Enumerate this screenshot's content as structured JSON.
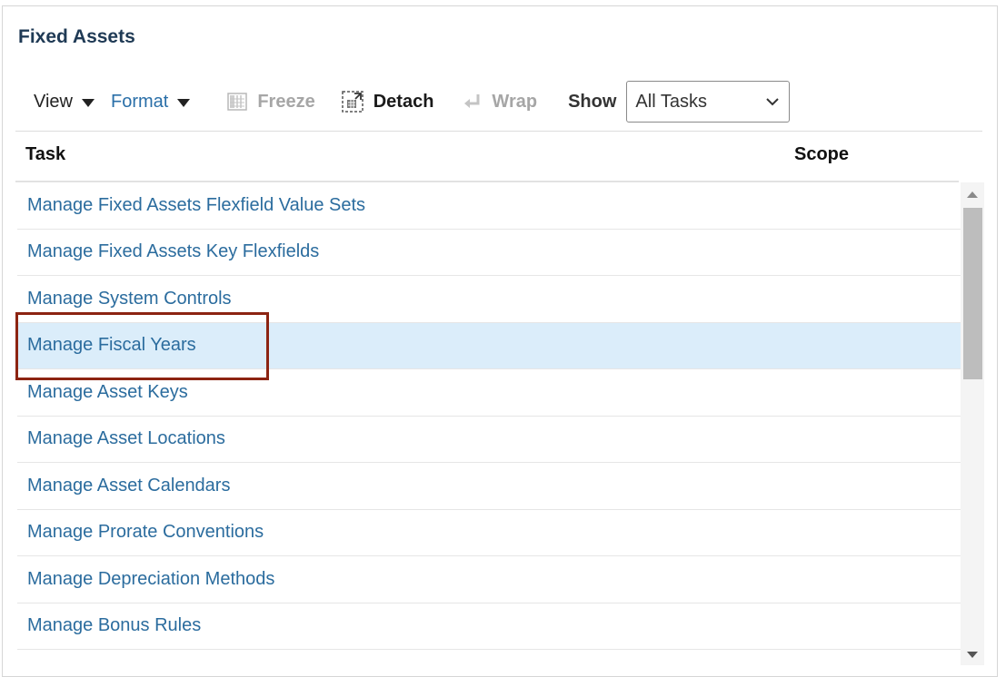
{
  "panel": {
    "title": "Fixed Assets"
  },
  "toolbar": {
    "view_label": "View",
    "format_label": "Format",
    "freeze_label": "Freeze",
    "detach_label": "Detach",
    "wrap_label": "Wrap",
    "show_label": "Show",
    "show_selected": "All Tasks"
  },
  "table": {
    "columns": [
      "Task",
      "Scope"
    ],
    "rows": [
      {
        "task": "Manage Fixed Assets Flexfield Value Sets"
      },
      {
        "task": "Manage Fixed Assets Key Flexfields"
      },
      {
        "task": "Manage System Controls"
      },
      {
        "task": "Manage Fiscal Years",
        "selected": true
      },
      {
        "task": "Manage Asset Keys"
      },
      {
        "task": "Manage Asset Locations"
      },
      {
        "task": "Manage Asset Calendars"
      },
      {
        "task": "Manage Prorate Conventions"
      },
      {
        "task": "Manage Depreciation Methods"
      },
      {
        "task": "Manage Bonus Rules"
      }
    ]
  },
  "colors": {
    "link": "#2b6c9e",
    "selected_row": "#dbedfa",
    "highlight_box": "#8c2412",
    "title": "#1f3a55"
  },
  "icons": {
    "view": "caret-down-icon",
    "format": "caret-down-icon",
    "freeze": "freeze-columns-icon",
    "detach": "detach-icon",
    "wrap": "wrap-icon",
    "select": "chevron-down-icon"
  }
}
